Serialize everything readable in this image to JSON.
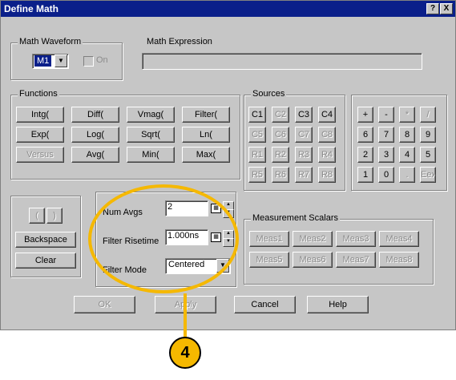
{
  "dialog": {
    "title": "Define Math",
    "help_label": "?",
    "close_label": "X"
  },
  "math_waveform": {
    "group_label": "Math Waveform",
    "selected": "M1",
    "on_label": "On"
  },
  "math_expression": {
    "label": "Math Expression",
    "value": ""
  },
  "functions": {
    "group_label": "Functions",
    "buttons": [
      {
        "label": "Intg(",
        "enabled": true
      },
      {
        "label": "Diff(",
        "enabled": true
      },
      {
        "label": "Vmag(",
        "enabled": true
      },
      {
        "label": "Filter(",
        "enabled": true
      },
      {
        "label": "Exp(",
        "enabled": true
      },
      {
        "label": "Log(",
        "enabled": true
      },
      {
        "label": "Sqrt(",
        "enabled": true
      },
      {
        "label": "Ln(",
        "enabled": true
      },
      {
        "label": "Versus",
        "enabled": false
      },
      {
        "label": "Avg(",
        "enabled": true
      },
      {
        "label": "Min(",
        "enabled": true
      },
      {
        "label": "Max(",
        "enabled": true
      }
    ]
  },
  "sources": {
    "group_label": "Sources",
    "buttons": [
      {
        "label": "C1",
        "enabled": true
      },
      {
        "label": "C2",
        "enabled": false
      },
      {
        "label": "C3",
        "enabled": true
      },
      {
        "label": "C4",
        "enabled": true
      },
      {
        "label": "C5",
        "enabled": false
      },
      {
        "label": "C6",
        "enabled": false
      },
      {
        "label": "C7",
        "enabled": false
      },
      {
        "label": "C8",
        "enabled": false
      },
      {
        "label": "R1",
        "enabled": false
      },
      {
        "label": "R2",
        "enabled": false
      },
      {
        "label": "R3",
        "enabled": false
      },
      {
        "label": "R4",
        "enabled": false
      },
      {
        "label": "R5",
        "enabled": false
      },
      {
        "label": "R6",
        "enabled": false
      },
      {
        "label": "R7",
        "enabled": false
      },
      {
        "label": "R8",
        "enabled": false
      }
    ]
  },
  "keypad": {
    "buttons": [
      {
        "label": "+",
        "enabled": true
      },
      {
        "label": "-",
        "enabled": true
      },
      {
        "label": "*",
        "enabled": false
      },
      {
        "label": "/",
        "enabled": false
      },
      {
        "label": "6",
        "enabled": true
      },
      {
        "label": "7",
        "enabled": true
      },
      {
        "label": "8",
        "enabled": true
      },
      {
        "label": "9",
        "enabled": true
      },
      {
        "label": "2",
        "enabled": true
      },
      {
        "label": "3",
        "enabled": true
      },
      {
        "label": "4",
        "enabled": true
      },
      {
        "label": "5",
        "enabled": true
      },
      {
        "label": "1",
        "enabled": true
      },
      {
        "label": "0",
        "enabled": true
      },
      {
        "label": ".",
        "enabled": false
      },
      {
        "label": "Eex",
        "enabled": false
      }
    ]
  },
  "edit": {
    "open_paren": "(",
    "close_paren": ")",
    "backspace": "Backspace",
    "clear": "Clear"
  },
  "averaging": {
    "num_avgs_label": "Num Avgs",
    "num_avgs_value": "2",
    "filter_risetime_label": "Filter Risetime",
    "filter_risetime_value": "1.000ns",
    "filter_mode_label": "Filter Mode",
    "filter_mode_value": "Centered"
  },
  "measurement_scalars": {
    "group_label": "Measurement Scalars",
    "buttons": [
      "Meas1",
      "Meas2",
      "Meas3",
      "Meas4",
      "Meas5",
      "Meas6",
      "Meas7",
      "Meas8"
    ]
  },
  "footer": {
    "ok": "OK",
    "apply": "Apply",
    "cancel": "Cancel",
    "help": "Help"
  },
  "annotation": {
    "callout_number": "4",
    "highlight_color": "#f5b800"
  }
}
